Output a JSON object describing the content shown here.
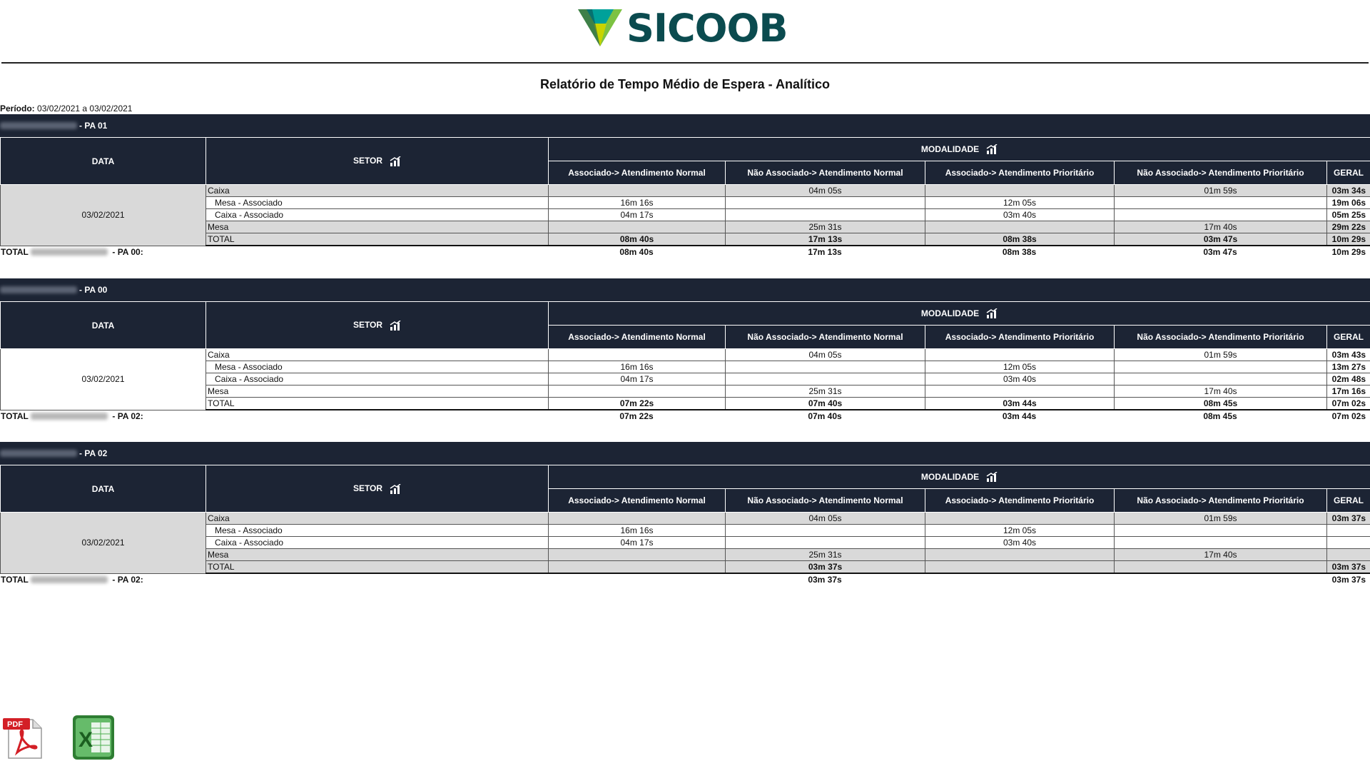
{
  "brand": {
    "name": "SICOOB"
  },
  "report": {
    "title": "Relatório de Tempo Médio de Espera - Analítico",
    "period_label": "Período:",
    "period_value": "03/02/2021 a 03/02/2021"
  },
  "headers": {
    "data": "DATA",
    "setor": "SETOR",
    "modalidade": "MODALIDADE",
    "cols": [
      "Associado-> Atendimento Normal",
      "Não Associado-> Atendimento Normal",
      "Associado-> Atendimento Prioritário",
      "Não Associado-> Atendimento Prioritário",
      "GERAL"
    ]
  },
  "sections": [
    {
      "title": "- PA 01",
      "date": "03/02/2021",
      "rows": [
        {
          "setor": "Caixa",
          "v": [
            "",
            "04m 05s",
            "",
            "01m 59s",
            "03m 34s"
          ]
        },
        {
          "setor": "Mesa - Associado",
          "v": [
            "16m 16s",
            "",
            "12m 05s",
            "",
            "19m 06s"
          ]
        },
        {
          "setor": "Caixa - Associado",
          "v": [
            "04m 17s",
            "",
            "03m 40s",
            "",
            "05m 25s"
          ]
        },
        {
          "setor": "Mesa",
          "v": [
            "",
            "25m 31s",
            "",
            "17m 40s",
            "29m 22s"
          ]
        },
        {
          "setor": "TOTAL",
          "v": [
            "08m 40s",
            "17m 13s",
            "08m 38s",
            "03m 47s",
            "10m 29s"
          ]
        }
      ],
      "total_prefix": "TOTAL",
      "total_suffix": "- PA 00:",
      "total_values": [
        "08m 40s",
        "17m 13s",
        "08m 38s",
        "03m 47s",
        "10m 29s"
      ]
    },
    {
      "title": "- PA 00",
      "date": "03/02/2021",
      "rows": [
        {
          "setor": "Caixa",
          "v": [
            "",
            "04m 05s",
            "",
            "01m 59s",
            "03m 43s"
          ]
        },
        {
          "setor": "Mesa - Associado",
          "v": [
            "16m 16s",
            "",
            "12m 05s",
            "",
            "13m 27s"
          ]
        },
        {
          "setor": "Caixa - Associado",
          "v": [
            "04m 17s",
            "",
            "03m 40s",
            "",
            "02m 48s"
          ]
        },
        {
          "setor": "Mesa",
          "v": [
            "",
            "25m 31s",
            "",
            "17m 40s",
            "17m 16s"
          ]
        },
        {
          "setor": "TOTAL",
          "v": [
            "07m 22s",
            "07m 40s",
            "03m 44s",
            "08m 45s",
            "07m 02s"
          ]
        }
      ],
      "total_prefix": "TOTAL",
      "total_suffix": "- PA 02:",
      "total_values": [
        "07m 22s",
        "07m 40s",
        "03m 44s",
        "08m 45s",
        "07m 02s"
      ]
    },
    {
      "title": "- PA 02",
      "date": "03/02/2021",
      "rows": [
        {
          "setor": "Caixa",
          "v": [
            "",
            "04m 05s",
            "",
            "01m 59s",
            "03m 37s"
          ]
        },
        {
          "setor": "Mesa - Associado",
          "v": [
            "16m 16s",
            "",
            "12m 05s",
            "",
            ""
          ]
        },
        {
          "setor": "Caixa - Associado",
          "v": [
            "04m 17s",
            "",
            "03m 40s",
            "",
            ""
          ]
        },
        {
          "setor": "Mesa",
          "v": [
            "",
            "25m 31s",
            "",
            "17m 40s",
            ""
          ]
        },
        {
          "setor": "TOTAL",
          "v": [
            "",
            "03m 37s",
            "",
            "",
            "03m 37s"
          ]
        }
      ],
      "total_prefix": "TOTAL",
      "total_suffix": "- PA 02:",
      "total_values": [
        "",
        "03m 37s",
        "",
        "",
        "03m 37s"
      ]
    }
  ],
  "downloads": {
    "pdf_label": "PDF",
    "excel_label": "X"
  },
  "icons": {
    "sort": "chart-sort-icon",
    "pdf": "pdf-icon",
    "excel": "excel-icon"
  },
  "colors": {
    "header_bg": "#1c2434",
    "shade": "#d9d9d9",
    "brand": "#0b4b4f"
  }
}
